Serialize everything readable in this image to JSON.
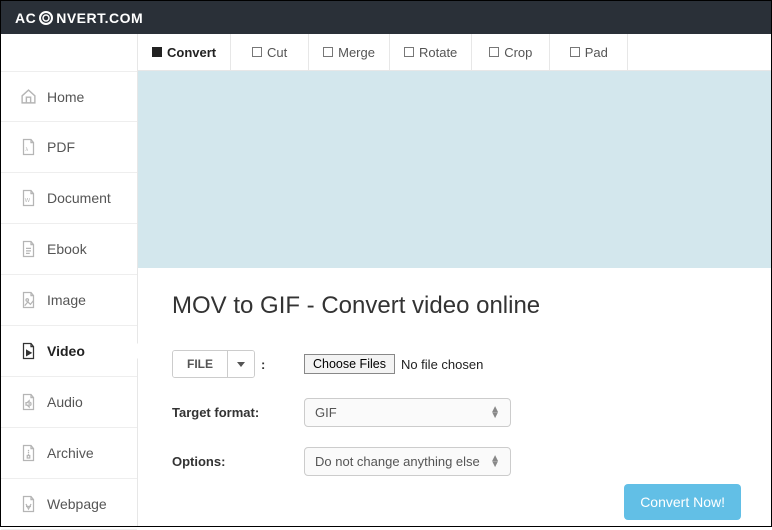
{
  "brand": {
    "prefix": "AC",
    "suffix": "NVERT.COM"
  },
  "sidebar": {
    "items": [
      {
        "label": "Home"
      },
      {
        "label": "PDF"
      },
      {
        "label": "Document"
      },
      {
        "label": "Ebook"
      },
      {
        "label": "Image"
      },
      {
        "label": "Video"
      },
      {
        "label": "Audio"
      },
      {
        "label": "Archive"
      },
      {
        "label": "Webpage"
      }
    ]
  },
  "tabs": [
    {
      "label": "Convert"
    },
    {
      "label": "Cut"
    },
    {
      "label": "Merge"
    },
    {
      "label": "Rotate"
    },
    {
      "label": "Crop"
    },
    {
      "label": "Pad"
    }
  ],
  "page": {
    "title": "MOV to GIF - Convert video online",
    "file_source_label": "FILE",
    "choose_files_label": "Choose Files",
    "no_file_text": "No file chosen",
    "target_format_label": "Target format:",
    "target_format_value": "GIF",
    "options_label": "Options:",
    "options_value": "Do not change anything else",
    "convert_button": "Convert Now!"
  }
}
